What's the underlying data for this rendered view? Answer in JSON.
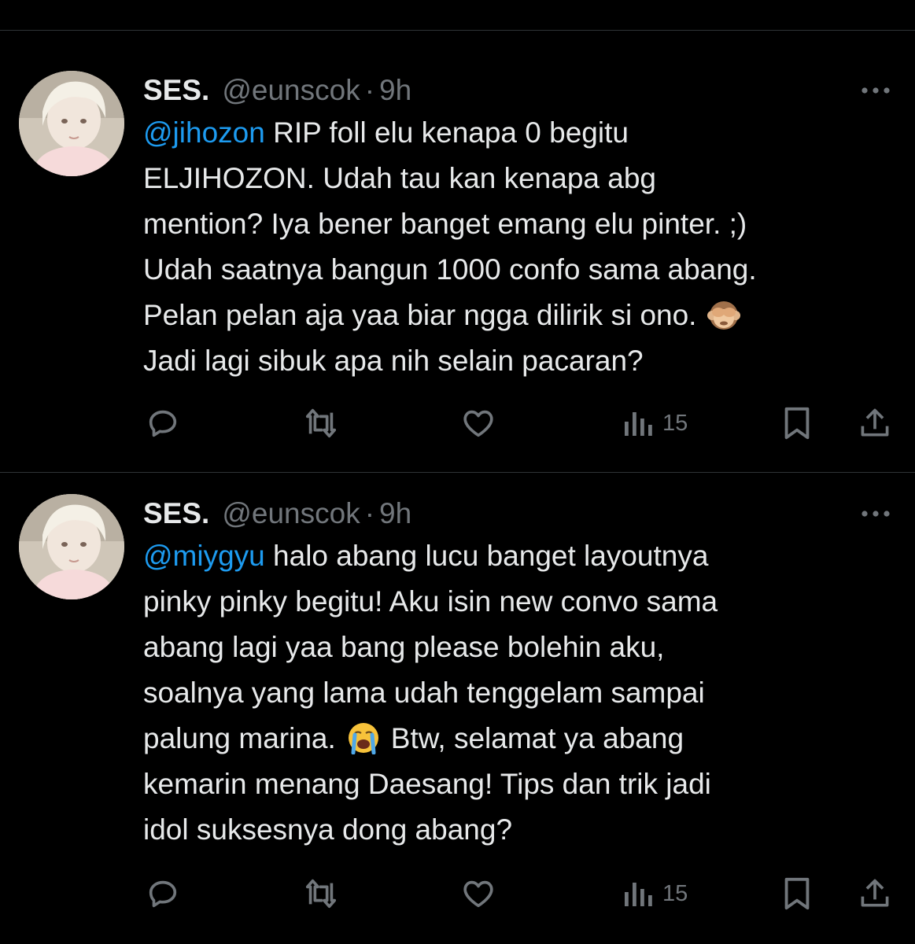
{
  "tweets": [
    {
      "author": {
        "name": "SES.",
        "handle": "@eunscok",
        "separator": "·",
        "time": "9h"
      },
      "body": {
        "mention": "@jihozon",
        "line1_rest": "RIP foll elu kenapa 0 begitu",
        "line2": "ELJIHOZON. Udah tau kan kenapa abg",
        "line3": "mention? Iya bener banget emang elu pinter. ;)",
        "line4": "Udah saatnya bangun 1000 confo sama abang.",
        "line5": "Pelan pelan aja yaa biar ngga dilirik si ono.",
        "line5_emoji": "🙈",
        "line6": "Jadi lagi sibuk apa nih selain pacaran?"
      },
      "actions": {
        "views_count": "15"
      }
    },
    {
      "author": {
        "name": "SES.",
        "handle": "@eunscok",
        "separator": "·",
        "time": "9h"
      },
      "body": {
        "mention": "@miygyu",
        "line1_rest": "halo abang lucu banget layoutnya",
        "line2": "pinky pinky begitu! Aku isin new convo sama",
        "line3": "abang lagi yaa bang please bolehin aku,",
        "line4": "soalnya yang lama udah tenggelam sampai",
        "line5_start": "palung marina.",
        "line5_emoji": "😭",
        "line5_end": "Btw, selamat ya abang",
        "line6": "kemarin menang Daesang! Tips dan trik jadi",
        "line7": "idol suksesnya dong abang?"
      },
      "actions": {
        "views_count": "15"
      }
    }
  ],
  "icons": {
    "reply": "reply-icon",
    "retweet": "retweet-icon",
    "like": "heart-icon",
    "views": "views-icon",
    "bookmark": "bookmark-icon",
    "share": "share-icon",
    "more": "more-icon"
  },
  "colors": {
    "background": "#000000",
    "text": "#e7e9ea",
    "secondary": "#71767b",
    "link": "#1d9bf0",
    "divider": "#2f3336"
  }
}
